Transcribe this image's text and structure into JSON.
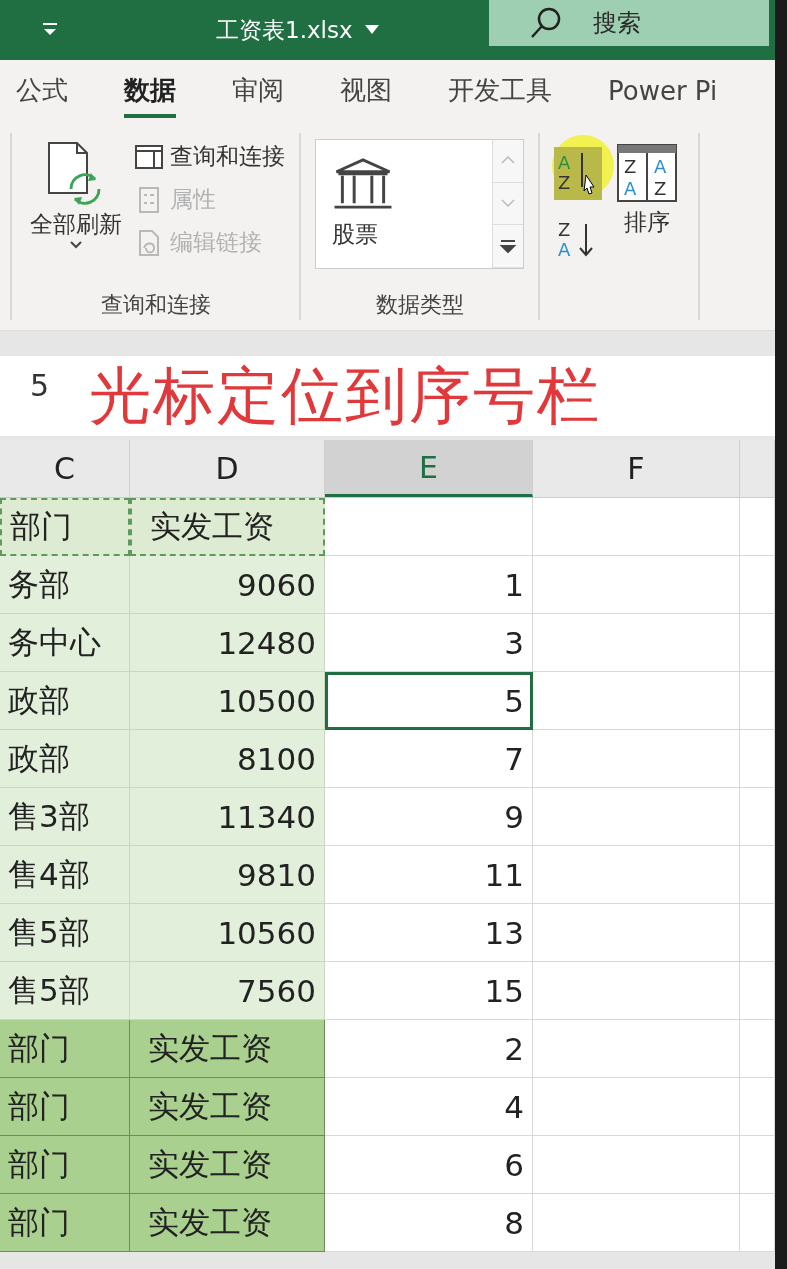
{
  "title_bar": {
    "title": "工资表1.xlsx",
    "search": {
      "placeholder": "搜索"
    }
  },
  "tabs": [
    {
      "label": "公式",
      "selected": false
    },
    {
      "label": "数据",
      "selected": true
    },
    {
      "label": "审阅",
      "selected": false
    },
    {
      "label": "视图",
      "selected": false
    },
    {
      "label": "开发工具",
      "selected": false
    },
    {
      "label": "Power Pi",
      "selected": false
    }
  ],
  "ribbon": {
    "groups": [
      {
        "label": "查询和连接",
        "big_button": "全部刷新",
        "items": [
          {
            "label": "查询和连接",
            "disabled": false
          },
          {
            "label": "属性",
            "disabled": true
          },
          {
            "label": "编辑链接",
            "disabled": true
          }
        ]
      },
      {
        "label": "数据类型",
        "gallery_item": "股票"
      },
      {
        "sort_button": "排序",
        "ascending_icon": [
          "A",
          "Z"
        ],
        "descending_icon": [
          "Z",
          "A"
        ],
        "sort_icon": [
          "Z",
          "A",
          "A",
          "Z"
        ]
      }
    ]
  },
  "formula_bar": {
    "value": "5"
  },
  "annotation": "光标定位到序号栏",
  "columns": [
    {
      "label": "C",
      "selected": false
    },
    {
      "label": "D",
      "selected": false
    },
    {
      "label": "E",
      "selected": true
    },
    {
      "label": "F",
      "selected": false
    }
  ],
  "rows": [
    {
      "kind": "header",
      "cells": [
        "部门",
        "实发工资",
        ""
      ],
      "copied": true,
      "selected": false
    },
    {
      "kind": "data",
      "cells": [
        "务部",
        "9060",
        "1"
      ],
      "copied": false,
      "selected": false
    },
    {
      "kind": "data",
      "cells": [
        "务中心",
        "12480",
        "3"
      ],
      "copied": false,
      "selected": false
    },
    {
      "kind": "data",
      "cells": [
        "政部",
        "10500",
        "5"
      ],
      "copied": false,
      "selected": true
    },
    {
      "kind": "data",
      "cells": [
        "政部",
        "8100",
        "7"
      ],
      "copied": false,
      "selected": false
    },
    {
      "kind": "data",
      "cells": [
        "售3部",
        "11340",
        "9"
      ],
      "copied": false,
      "selected": false
    },
    {
      "kind": "data",
      "cells": [
        "售4部",
        "9810",
        "11"
      ],
      "copied": false,
      "selected": false
    },
    {
      "kind": "data",
      "cells": [
        "售5部",
        "10560",
        "13"
      ],
      "copied": false,
      "selected": false
    },
    {
      "kind": "data",
      "cells": [
        "售5部",
        "7560",
        "15"
      ],
      "copied": false,
      "selected": false
    },
    {
      "kind": "header",
      "cells": [
        "部门",
        "实发工资",
        "2"
      ],
      "copied": false,
      "selected": false
    },
    {
      "kind": "header",
      "cells": [
        "部门",
        "实发工资",
        "4"
      ],
      "copied": false,
      "selected": false
    },
    {
      "kind": "header",
      "cells": [
        "部门",
        "实发工资",
        "6"
      ],
      "copied": false,
      "selected": false
    },
    {
      "kind": "header",
      "cells": [
        "部门",
        "实发工资",
        "8"
      ],
      "copied": false,
      "selected": false
    }
  ]
}
